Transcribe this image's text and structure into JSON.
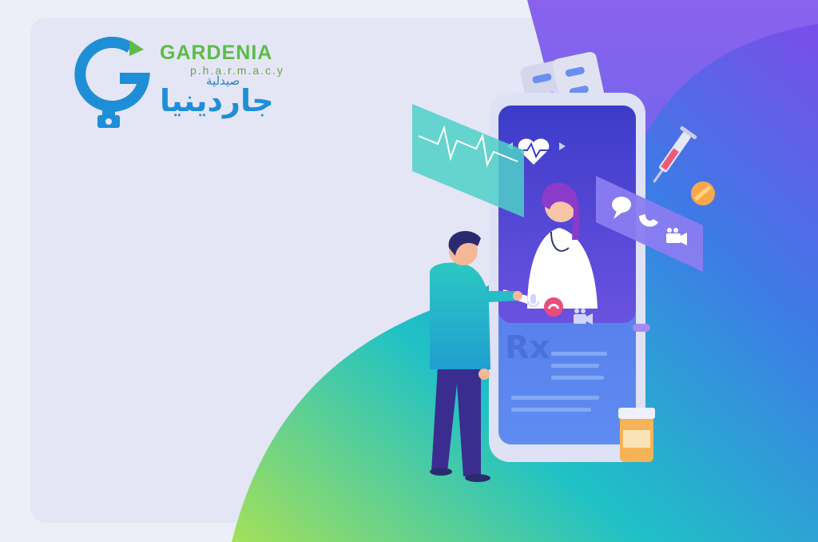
{
  "brand": {
    "name": "GARDENIA",
    "sub": "p.h.a.r.m.a.c.y",
    "arabic_small": "صيدلية",
    "arabic_large": "جاردينيا"
  },
  "colors": {
    "brand_green": "#5dbb46",
    "brand_blue": "#1e8fd6",
    "gradient_start": "#a4e05a",
    "gradient_mid": "#1fc1c6",
    "gradient_end": "#7a4dea"
  },
  "illustration": {
    "icons": [
      "heart-rate-icon",
      "chat-bubble-icon",
      "phone-icon",
      "video-camera-icon",
      "syringe-icon",
      "pill-icon",
      "rx-icon",
      "microphone-icon",
      "end-call-icon"
    ]
  }
}
